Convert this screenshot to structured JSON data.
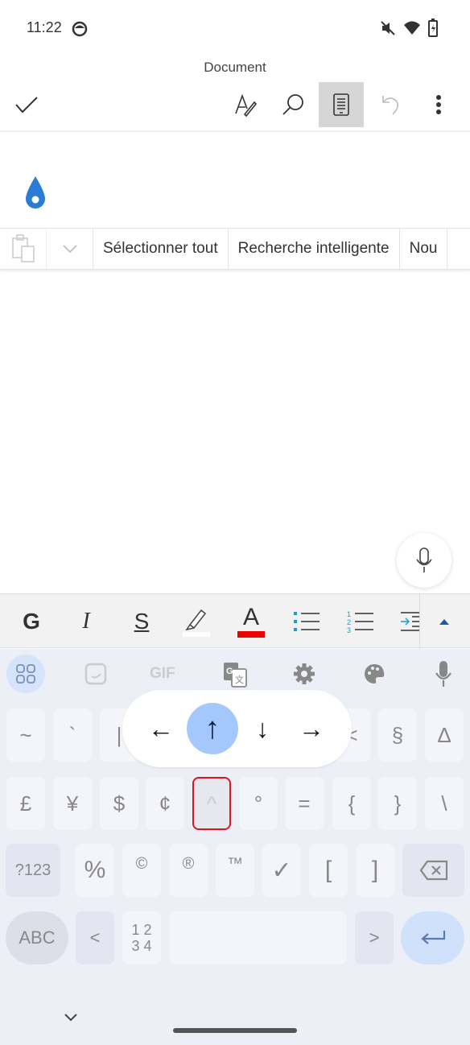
{
  "status_bar": {
    "time": "11:22",
    "icons": [
      "face-icon",
      "mute-icon",
      "wifi-icon",
      "battery-charging-icon"
    ]
  },
  "header": {
    "title": "Document",
    "icons": [
      "check-icon",
      "draw-icon",
      "search-icon",
      "reading-view-icon",
      "undo-icon",
      "more-icon"
    ]
  },
  "context_menu": {
    "items": [
      "Sélectionner tout",
      "Recherche intelligente",
      "Nou"
    ]
  },
  "format_bar": {
    "bold": "G",
    "italic": "I",
    "strike": "S",
    "font_color": "A",
    "highlight_color": "#ffffff",
    "font_color_value": "#ee0000",
    "accent": "#1a9bd7"
  },
  "keyboard": {
    "toolbar": [
      "apps-icon",
      "sticker-icon",
      "GIF",
      "translate-icon",
      "settings-icon",
      "palette-icon",
      "mic-icon"
    ],
    "popup": {
      "keys": [
        "←",
        "↑",
        "↓",
        "→"
      ],
      "selected": "↑"
    },
    "row1": [
      "~",
      "`",
      "|",
      "<",
      "§",
      "Δ"
    ],
    "row2": [
      "£",
      "¥",
      "$",
      "¢",
      "^",
      "°",
      "=",
      "{",
      "}",
      "\\"
    ],
    "row3": [
      "?123",
      "%",
      "©",
      "®",
      "™",
      "✓",
      "[",
      "]"
    ],
    "row4": {
      "abc": "ABC",
      "left": "<",
      "numpad": "1 2\n3 4",
      "right": ">"
    },
    "highlight_color": "#e0141e",
    "enter_color": "#cfe1fb"
  }
}
